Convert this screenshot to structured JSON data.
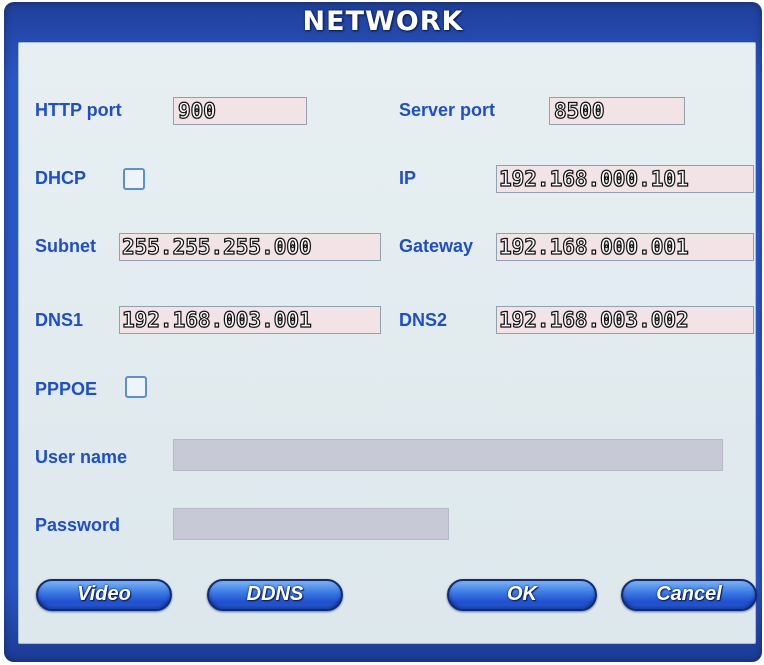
{
  "window": {
    "title": "NETWORK"
  },
  "fields": {
    "http_port": {
      "label": "HTTP port",
      "value": "900"
    },
    "server_port": {
      "label": "Server port",
      "value": "8500"
    },
    "dhcp": {
      "label": "DHCP",
      "checked": false
    },
    "ip": {
      "label": "IP",
      "value": "192.168.000.101"
    },
    "subnet": {
      "label": "Subnet",
      "value": "255.255.255.000"
    },
    "gateway": {
      "label": "Gateway",
      "value": "192.168.000.001"
    },
    "dns1": {
      "label": "DNS1",
      "value": "192.168.003.001"
    },
    "dns2": {
      "label": "DNS2",
      "value": "192.168.003.002"
    },
    "pppoe": {
      "label": "PPPOE",
      "checked": false
    },
    "user_name": {
      "label": "User name",
      "value": ""
    },
    "password": {
      "label": "Password",
      "value": ""
    }
  },
  "buttons": {
    "video": "Video",
    "ddns": "DDNS",
    "ok": "OK",
    "cancel": "Cancel"
  },
  "colors": {
    "frame": "#2a56c4",
    "panel": "#e3ecef",
    "label": "#1f4fc8",
    "input_box": "#f2e3e6",
    "disabled_input": "#c8c9d6"
  }
}
